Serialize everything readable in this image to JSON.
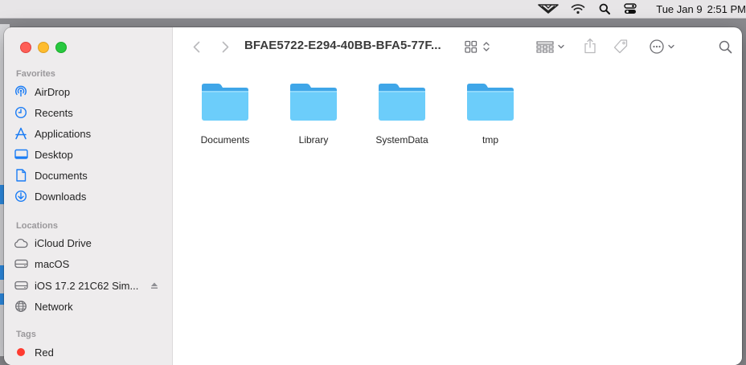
{
  "menubar": {
    "day": "Tue Jan 9",
    "time": "2:51 PM",
    "icons": [
      "app-icon",
      "wifi-icon",
      "search-icon",
      "control-center-icon"
    ]
  },
  "window": {
    "title": "BFAE5722-E294-40BB-BFA5-77F...",
    "toolbar_icons": [
      "back-icon",
      "forward-icon",
      "view-icon",
      "group-icon",
      "share-icon",
      "tag-icon",
      "more-icon",
      "search-icon"
    ]
  },
  "sidebar": {
    "favorites_header": "Favorites",
    "favorites": [
      {
        "label": "AirDrop",
        "icon": "airdrop-icon"
      },
      {
        "label": "Recents",
        "icon": "clock-icon"
      },
      {
        "label": "Applications",
        "icon": "applications-icon"
      },
      {
        "label": "Desktop",
        "icon": "desktop-icon"
      },
      {
        "label": "Documents",
        "icon": "document-icon"
      },
      {
        "label": "Downloads",
        "icon": "download-icon"
      }
    ],
    "locations_header": "Locations",
    "locations": [
      {
        "label": "iCloud Drive",
        "icon": "cloud-icon"
      },
      {
        "label": "macOS",
        "icon": "drive-icon"
      },
      {
        "label": "iOS 17.2 21C62 Sim...",
        "icon": "drive-icon"
      },
      {
        "label": "Network",
        "icon": "globe-icon"
      }
    ],
    "tags_header": "Tags",
    "tags": [
      {
        "label": "Red",
        "color": "#ff3b30"
      }
    ]
  },
  "files": [
    {
      "name": "Documents",
      "icon": "folder-icon"
    },
    {
      "name": "Library",
      "icon": "folder-icon"
    },
    {
      "name": "SystemData",
      "icon": "folder-icon"
    },
    {
      "name": "tmp",
      "icon": "folder-icon"
    }
  ],
  "colors": {
    "accent": "#1a7cf5",
    "folder": "#6ccdfa",
    "folder_tab": "#3fa6e8"
  }
}
